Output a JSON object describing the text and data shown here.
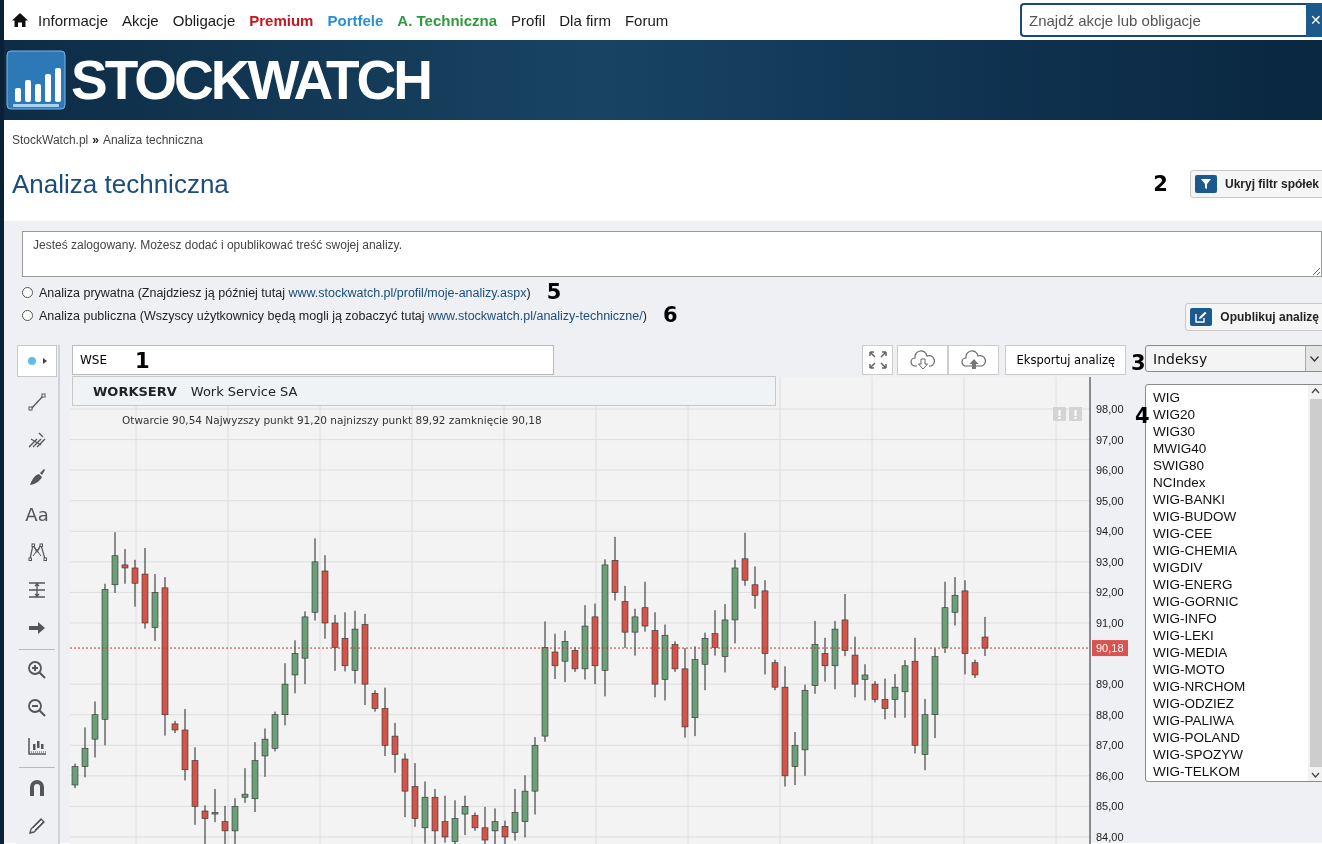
{
  "nav": {
    "items": [
      {
        "label": "Informacje",
        "color": "#1a1a1a",
        "emphasized": false
      },
      {
        "label": "Akcje",
        "color": "#1a1a1a",
        "emphasized": false
      },
      {
        "label": "Obligacje",
        "color": "#1a1a1a",
        "emphasized": false
      },
      {
        "label": "Premium",
        "color": "#c4161c",
        "emphasized": true
      },
      {
        "label": "Portfele",
        "color": "#2b8fd8",
        "emphasized": true
      },
      {
        "label": "A. Techniczna",
        "color": "#2f9a3e",
        "emphasized": true
      },
      {
        "label": "Profil",
        "color": "#1a1a1a",
        "emphasized": false
      },
      {
        "label": "Dla firm",
        "color": "#1a1a1a",
        "emphasized": false
      },
      {
        "label": "Forum",
        "color": "#1a1a1a",
        "emphasized": false
      }
    ],
    "search": {
      "placeholder": "Znajdź akcje lub obligacje"
    },
    "clear": "✕"
  },
  "logo": {
    "text": "STOCKWATCH"
  },
  "breadcrumb": {
    "items": [
      "StockWatch.pl",
      "Analiza techniczna"
    ],
    "separator": "»"
  },
  "title": "Analiza techniczna",
  "filter_button": {
    "label": "Ukryj filtr spółek",
    "marker": "2"
  },
  "editor": {
    "value": "Jesteś zalogowany. Możesz dodać i opublikować treść swojej analizy."
  },
  "visibility_options": [
    {
      "text": "Analiza prywatna (Znajdziesz ją później tutaj",
      "link": "www.stockwatch.pl/profil/moje-analizy.aspx",
      "suffix": ")",
      "selected": false,
      "marker": "5"
    },
    {
      "text": "Analiza publiczna (Wszyscy użytkownicy będą mogli ją zobaczyć tutaj",
      "link": "www.stockwatch.pl/analizy-techniczne/",
      "suffix": ")",
      "selected": false,
      "marker": "6"
    }
  ],
  "publish_button": {
    "label": "Opublikuj analizę"
  },
  "tools": {
    "text_tool": "Aa"
  },
  "symbol_input": {
    "value": "WSE",
    "marker": "1"
  },
  "suggestion": {
    "code": "WORKSERV",
    "name": "Work Service SA"
  },
  "export_button": {
    "label": "Eksportuj analizę"
  },
  "index_select": {
    "value": "Indeksy",
    "marker": "3"
  },
  "index_list": {
    "marker": "4",
    "items": [
      "WIG",
      "WIG20",
      "WIG30",
      "MWIG40",
      "SWIG80",
      "NCIndex",
      "WIG-BANKI",
      "WIG-BUDOW",
      "WIG-CEE",
      "WIG-CHEMIA",
      "WIGDIV",
      "WIG-ENERG",
      "WIG-GORNIC",
      "WIG-INFO",
      "WIG-LEKI",
      "WIG-MEDIA",
      "WIG-MOTO",
      "WIG-NRCHOM",
      "WIG-ODZIEZ",
      "WIG-PALIWA",
      "WIG-POLAND",
      "WIG-SPOZYW",
      "WIG-TELKOM"
    ]
  },
  "chart": {
    "info": "Otwarcie 90,54 Najwyzszy punkt 91,20 najnizszy punkt 89,92 zamknięcie 90,18",
    "y_ticks_above_price": [
      "98,00",
      "97,00",
      "96,00",
      "95,00",
      "94,00",
      "93,00",
      "92,00",
      "91,00"
    ],
    "y_ticks_below_price": [
      "89,00",
      "88,00",
      "87,00",
      "86,00",
      "85,00",
      "84,00"
    ],
    "last_price": "90,18"
  }
}
